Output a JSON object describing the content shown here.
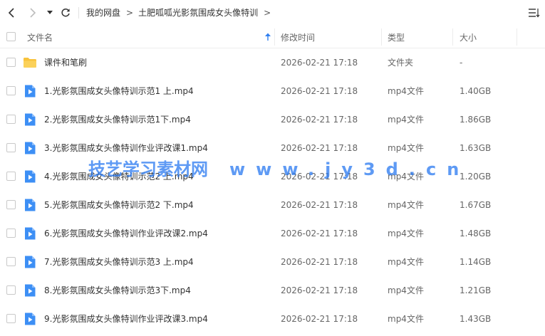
{
  "navigation": {
    "breadcrumb": [
      "我的网盘",
      "土肥呱呱光影氛围成女头像特训"
    ]
  },
  "columns": {
    "name": "文件名",
    "modified": "修改时间",
    "type": "类型",
    "size": "大小"
  },
  "files": [
    {
      "name": "课件和笔刷",
      "modified": "2026-02-21 17:18",
      "type": "文件夹",
      "size": "-",
      "icon": "folder-icon"
    },
    {
      "name": "1.光影氛围成女头像特训示范1 上.mp4",
      "modified": "2026-02-21 17:18",
      "type": "mp4文件",
      "size": "1.40GB",
      "icon": "video-file-icon"
    },
    {
      "name": "2.光影氛围成女头像特训示范1下.mp4",
      "modified": "2026-02-21 17:18",
      "type": "mp4文件",
      "size": "1.86GB",
      "icon": "video-file-icon"
    },
    {
      "name": "3.光影氛围成女头像特训作业评改课1.mp4",
      "modified": "2026-02-21 17:18",
      "type": "mp4文件",
      "size": "1.63GB",
      "icon": "video-file-icon"
    },
    {
      "name": "4.光影氛围成女头像特训示范2 上.mp4",
      "modified": "2026-02-21 17:18",
      "type": "mp4文件",
      "size": "1.20GB",
      "icon": "video-file-icon"
    },
    {
      "name": "5.光影氛围成女头像特训示范2 下.mp4",
      "modified": "2026-02-21 17:18",
      "type": "mp4文件",
      "size": "1.67GB",
      "icon": "video-file-icon"
    },
    {
      "name": "6.光影氛围成女头像特训作业评改课2.mp4",
      "modified": "2026-02-21 17:18",
      "type": "mp4文件",
      "size": "1.48GB",
      "icon": "video-file-icon"
    },
    {
      "name": "7.光影氛围成女头像特训示范3 上.mp4",
      "modified": "2026-02-21 17:18",
      "type": "mp4文件",
      "size": "1.14GB",
      "icon": "video-file-icon"
    },
    {
      "name": "8.光影氛围成女头像特训示范3下.mp4",
      "modified": "2026-02-21 17:18",
      "type": "mp4文件",
      "size": "1.21GB",
      "icon": "video-file-icon"
    },
    {
      "name": "9.光影氛围成女头像特训作业评改课3.mp4",
      "modified": "2026-02-21 17:18",
      "type": "mp4文件",
      "size": "1.43GB",
      "icon": "video-file-icon"
    }
  ],
  "watermark": {
    "text": "技艺学习素材网",
    "url": "www.jy3d.cn"
  },
  "colors": {
    "folder": "#f8c33c",
    "video": "#3d8ff5",
    "accent": "#2f7ff0"
  }
}
